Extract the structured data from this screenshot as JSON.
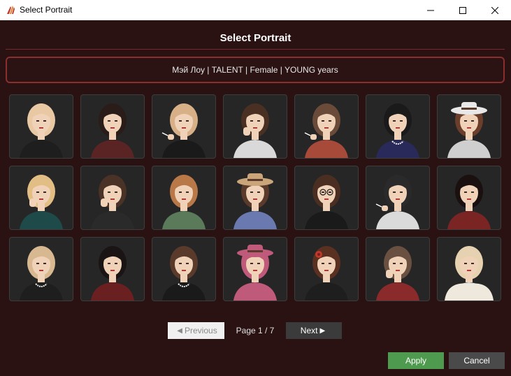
{
  "window": {
    "title": "Select Portrait",
    "icon": "app-feather-icon",
    "controls": [
      "minimize-icon",
      "maximize-icon",
      "close-icon"
    ]
  },
  "dialog": {
    "heading": "Select Portrait",
    "info": "Мэй Лоу | TALENT | Female | YOUNG years",
    "accent_color": "#8a2e2e",
    "background_color": "#2a1212"
  },
  "portraits": [
    {
      "hair": "#e8c9a4",
      "top": "#1e1e1e",
      "accessory": "none"
    },
    {
      "hair": "#2a1c18",
      "top": "#5a2424",
      "accessory": "none"
    },
    {
      "hair": "#d8b088",
      "top": "#1a1a1a",
      "accessory": "cigarette"
    },
    {
      "hair": "#4a3022",
      "top": "#d9d9d9",
      "accessory": "hand"
    },
    {
      "hair": "#6a4a38",
      "top": "#a84a3a",
      "accessory": "cigarette"
    },
    {
      "hair": "#1a1a1a",
      "top": "#2a2a5a",
      "accessory": "necklace"
    },
    {
      "hair": "#6a3e2a",
      "top": "#cfcfcf",
      "accessory": "hat"
    },
    {
      "hair": "#e2bd84",
      "top": "#1e4a4a",
      "accessory": "hand"
    },
    {
      "hair": "#4a3226",
      "top": "#2a2a2a",
      "accessory": "hand"
    },
    {
      "hair": "#b87848",
      "top": "#5a7a5a",
      "accessory": "none"
    },
    {
      "hair": "#5a3a2a",
      "top": "#6a7ab0",
      "accessory": "hat"
    },
    {
      "hair": "#4a2e22",
      "top": "#1a1a1a",
      "accessory": "glasses"
    },
    {
      "hair": "#2a2a2a",
      "top": "#dadada",
      "accessory": "cigarette"
    },
    {
      "hair": "#1a1010",
      "top": "#7a2424",
      "accessory": "none"
    },
    {
      "hair": "#d8b890",
      "top": "#1e1e1e",
      "accessory": "necklace"
    },
    {
      "hair": "#1a1414",
      "top": "#6a2020",
      "accessory": "none"
    },
    {
      "hair": "#5a3a2a",
      "top": "#1a1a1a",
      "accessory": "necklace"
    },
    {
      "hair": "#c05a7a",
      "top": "#c05a7a",
      "accessory": "hat"
    },
    {
      "hair": "#5a3020",
      "top": "#1e1e1e",
      "accessory": "flower"
    },
    {
      "hair": "#6a5040",
      "top": "#8a2a2a",
      "accessory": "hand"
    },
    {
      "hair": "#e6d2b0",
      "top": "#e0e0e0",
      "accessory": "fur"
    }
  ],
  "pagination": {
    "previous_label": "Previous",
    "page_label": "Page 1 / 7",
    "next_label": "Next",
    "previous_enabled": false
  },
  "actions": {
    "apply_label": "Apply",
    "cancel_label": "Cancel",
    "apply_color": "#4e9a4e"
  }
}
